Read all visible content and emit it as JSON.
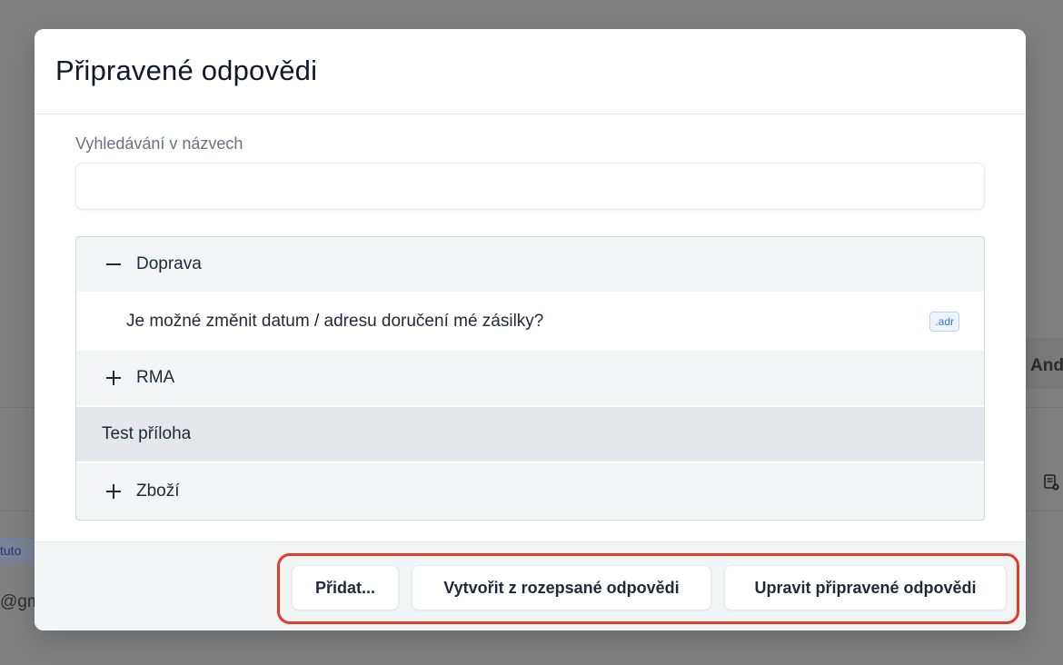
{
  "background": {
    "right_text": "And",
    "left_tag": "tuto",
    "left_email": "@gm"
  },
  "modal": {
    "title": "Připravené odpovědi",
    "search": {
      "label": "Vyhledávání v názvech",
      "value": "",
      "placeholder": ""
    },
    "tree": {
      "items": [
        {
          "label": "Doprava",
          "toggle": "minus-icon"
        },
        {
          "label": "Je možné změnit datum / adresu doručení mé zásilky?",
          "badge": ".adr"
        },
        {
          "label": "RMA",
          "toggle": "plus-icon"
        },
        {
          "label": "Test příloha"
        },
        {
          "label": "Zboží",
          "toggle": "plus-icon"
        }
      ]
    },
    "footer": {
      "add_label": "Přidat...",
      "create_label": "Vytvořit z rozepsané odpovědi",
      "edit_label": "Upravit připravené odpovědi"
    }
  },
  "colors": {
    "highlight": "#e23a2c",
    "badge_text": "#3b74d4",
    "overlay": "#808080"
  }
}
